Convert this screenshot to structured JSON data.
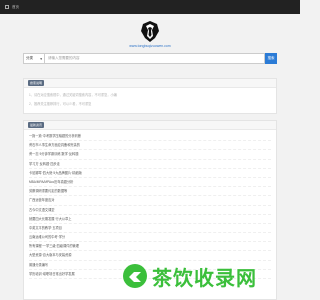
{
  "nav": {
    "home_label": "首页"
  },
  "hero": {
    "domain": "www.tongbuqizuowen.com"
  },
  "search": {
    "category": "分类",
    "placeholder": "请输入您需要的内容",
    "button_label": "搜索"
  },
  "notice": {
    "tag": "搜索说明",
    "lines": [
      "1、请在对应搜索框中，通过关键词搜索内容，不可重复，小编",
      "2、推荐关注推荐排行，可以少看，不可重复"
    ]
  },
  "list": {
    "tag": "最新资讯",
    "items": [
      "一篇一篇·中考数学压轴题的分析判断",
      "黄石市人事生命方面应具备和完善的",
      "黄一志·5分钟学霸训练 数学·反转题",
      "学习方·反转题·四步走",
      "卡尼娜琴·四大绝·5大品牌图片·精细版",
      "MBA/MPA/MPAcc历年真题分析",
      "劳察调研重要约定的数据等",
      "广西运营年度应对",
      "古今中文语文课堂",
      "就要四大长期发展·行大公章上",
      "中英文平的教学·五项目",
      "云南运维公司的中考·学分",
      "所有课程·一学三级·四级课件的管理",
      "大型资源·百大版本与安装资源",
      "普通分类编写",
      "学历培训·增职场日常出好学发展"
    ]
  },
  "watermark": {
    "text": "茶饮收录网"
  }
}
